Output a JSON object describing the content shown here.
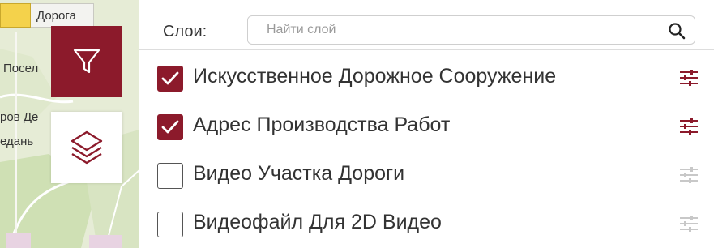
{
  "map": {
    "labels": {
      "road": "Дорога",
      "settlement": "Посел",
      "street": "ров Де",
      "street2": "едань"
    }
  },
  "buttons": {
    "filter_icon": "filter-icon",
    "layers_icon": "layers-icon"
  },
  "panel": {
    "header_label": "Слои:",
    "search": {
      "placeholder": "Найти слой",
      "value": ""
    },
    "layers": [
      {
        "label": "Искусственное Дорожное Сооружение",
        "checked": true
      },
      {
        "label": "Адрес Производства Работ",
        "checked": true
      },
      {
        "label": "Видео Участка Дороги",
        "checked": false
      },
      {
        "label": "Видеофайл Для 2D Видео",
        "checked": false
      }
    ]
  },
  "colors": {
    "accent": "#8c1a2b",
    "settings_active": "#8c1a2b",
    "settings_inactive": "#c8c8c8"
  }
}
